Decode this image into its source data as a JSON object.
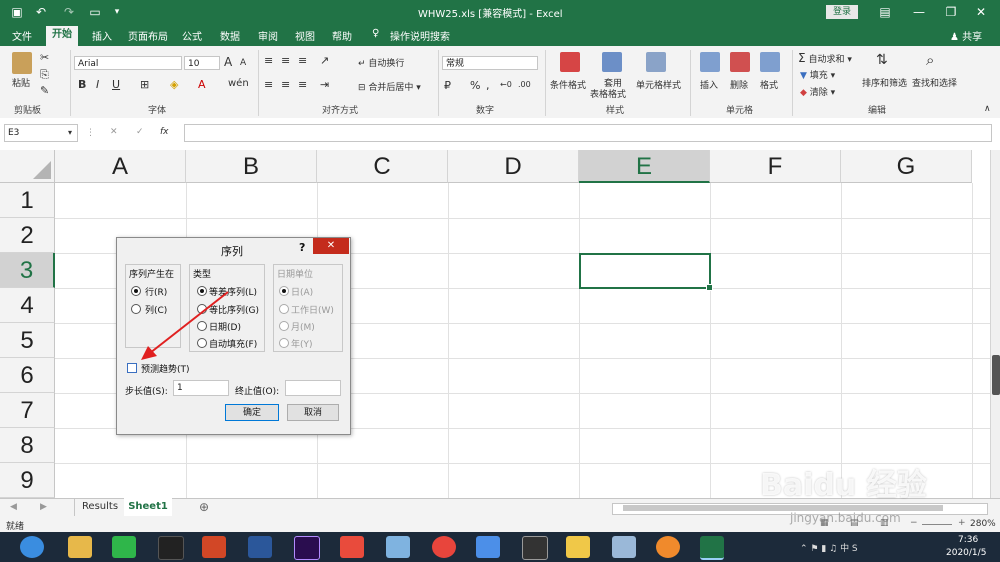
{
  "title_bar": {
    "filename": "WHW25.xls",
    "mode": "[兼容模式]",
    "app": "Excel",
    "login_label": "登录"
  },
  "tabs": [
    "文件",
    "开始",
    "插入",
    "页面布局",
    "公式",
    "数据",
    "审阅",
    "视图",
    "帮助",
    "操作说明搜索"
  ],
  "share_label": "共享",
  "ribbon": {
    "paste": "粘贴",
    "font_name": "Arial",
    "font_size": "10",
    "font_grow": "A",
    "font_shrink": "A",
    "wrap_text": "自动换行",
    "merge_center": "合并后居中",
    "number_format": "常规",
    "cond_format": "条件格式",
    "table_format_line1": "套用",
    "table_format_line2": "表格格式",
    "cell_style": "单元格样式",
    "insert": "插入",
    "delete": "删除",
    "format": "格式",
    "autosum": "自动求和",
    "fill": "填充",
    "clear": "清除",
    "sort_filter": "排序和筛选",
    "find_select": "查找和选择",
    "groups": {
      "clipboard": "剪贴板",
      "font": "字体",
      "alignment": "对齐方式",
      "number": "数字",
      "styles": "样式",
      "cells": "单元格",
      "editing": "编辑"
    }
  },
  "formula_bar": {
    "name_box": "E3",
    "fx": "fx",
    "value": ""
  },
  "grid": {
    "columns": [
      "A",
      "B",
      "C",
      "D",
      "E",
      "F",
      "G"
    ],
    "rows": [
      "1",
      "2",
      "3",
      "4",
      "5",
      "6",
      "7",
      "8",
      "9"
    ],
    "active_cell": "E3"
  },
  "dialog": {
    "title": "序列",
    "help": "?",
    "series_in": {
      "label": "序列产生在",
      "options": [
        "行(R)",
        "列(C)"
      ],
      "selected": "行(R)"
    },
    "type": {
      "label": "类型",
      "options": [
        "等差序列(L)",
        "等比序列(G)",
        "日期(D)",
        "自动填充(F)"
      ],
      "selected": "等差序列(L)"
    },
    "date_unit": {
      "label": "日期单位",
      "options": [
        "日(A)",
        "工作日(W)",
        "月(M)",
        "年(Y)"
      ],
      "selected": "日(A)",
      "disabled": true
    },
    "trend": {
      "label": "预测趋势(T)",
      "checked": false
    },
    "step": {
      "label": "步长值(S):",
      "value": "1"
    },
    "stop": {
      "label": "终止值(O):",
      "value": ""
    },
    "ok": "确定",
    "cancel": "取消"
  },
  "sheets": [
    {
      "name": "Results",
      "active": false
    },
    {
      "name": "Sheet1",
      "active": true
    }
  ],
  "status": {
    "text": "就绪",
    "zoom": "280%"
  },
  "taskbar": {
    "time": "7:36",
    "date": "2020/1/5"
  },
  "watermark": {
    "text": "Baidu 经验",
    "url": "jingyan.baidu.com"
  },
  "colors": {
    "accent": "#217346",
    "arrow": "#e02020",
    "active_cell_border": "#217346"
  }
}
